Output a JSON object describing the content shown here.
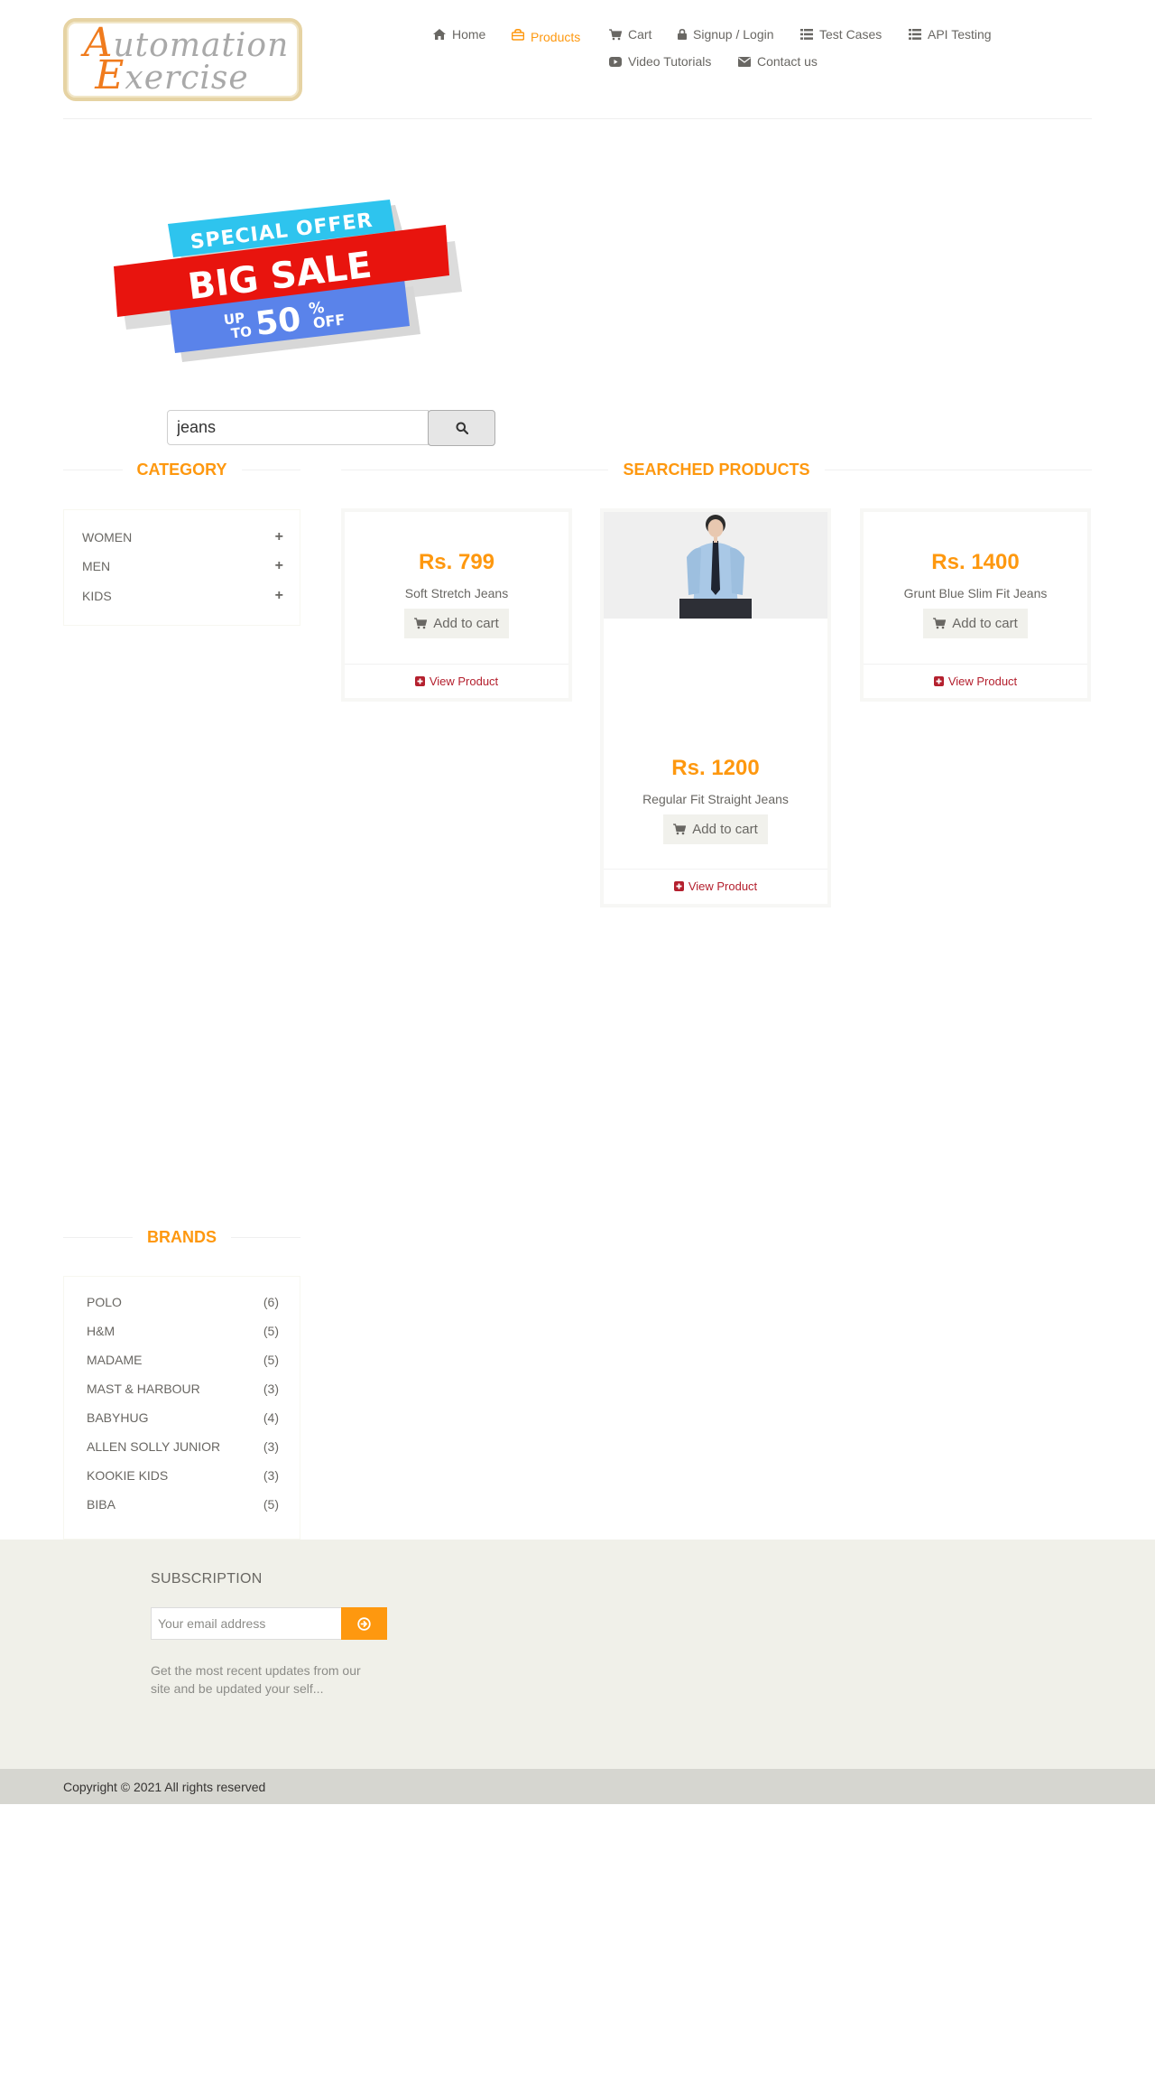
{
  "header": {
    "logo": {
      "line1": "Automation",
      "line2": "Exercise"
    },
    "nav": [
      {
        "label": "Home",
        "icon": "home-icon"
      },
      {
        "label": "Products",
        "icon": "shopping-bag-icon",
        "active": true
      },
      {
        "label": "Cart",
        "icon": "cart-icon"
      },
      {
        "label": "Signup / Login",
        "icon": "lock-icon"
      },
      {
        "label": "Test Cases",
        "icon": "list-icon"
      },
      {
        "label": "API Testing",
        "icon": "list-icon"
      },
      {
        "label": "Video Tutorials",
        "icon": "youtube-play-icon"
      },
      {
        "label": "Contact us",
        "icon": "envelope-icon"
      }
    ]
  },
  "banner": {
    "line1": "SPECIAL OFFER",
    "line2": "BIG SALE",
    "line3_up": "UP",
    "line3_to": "TO",
    "line3_pct": "50",
    "line3_sym": "%",
    "line3_off": "OFF"
  },
  "search": {
    "value": "jeans",
    "button_icon": "search-icon"
  },
  "sidebar": {
    "category_title": "CATEGORY",
    "categories": [
      {
        "label": "WOMEN"
      },
      {
        "label": "MEN"
      },
      {
        "label": "KIDS"
      }
    ],
    "brands_title": "BRANDS",
    "brands": [
      {
        "name": "POLO",
        "count": "(6)"
      },
      {
        "name": "H&M",
        "count": "(5)"
      },
      {
        "name": "MADAME",
        "count": "(5)"
      },
      {
        "name": "MAST & HARBOUR",
        "count": "(3)"
      },
      {
        "name": "BABYHUG",
        "count": "(4)"
      },
      {
        "name": "ALLEN SOLLY JUNIOR",
        "count": "(3)"
      },
      {
        "name": "KOOKIE KIDS",
        "count": "(3)"
      },
      {
        "name": "BIBA",
        "count": "(5)"
      }
    ]
  },
  "products": {
    "title": "SEARCHED PRODUCTS",
    "add_to_cart": "Add to cart",
    "view_product": "View Product",
    "items": [
      {
        "price": "Rs. 799",
        "name": "Soft Stretch Jeans"
      },
      {
        "price": "Rs. 1200",
        "name": "Regular Fit Straight Jeans"
      },
      {
        "price": "Rs. 1400",
        "name": "Grunt Blue Slim Fit Jeans"
      }
    ]
  },
  "footer": {
    "subscription_title": "SUBSCRIPTION",
    "email_placeholder": "Your email address",
    "subscription_text": "Get the most recent updates from our site and be updated your self...",
    "copyright": "Copyright © 2021 All rights reserved"
  },
  "colors": {
    "accent": "#fe980f",
    "link_red": "#b4202e",
    "text": "#696763",
    "footer_bg": "#f0f0e9",
    "footer_bottom_bg": "#d6d6d0"
  }
}
